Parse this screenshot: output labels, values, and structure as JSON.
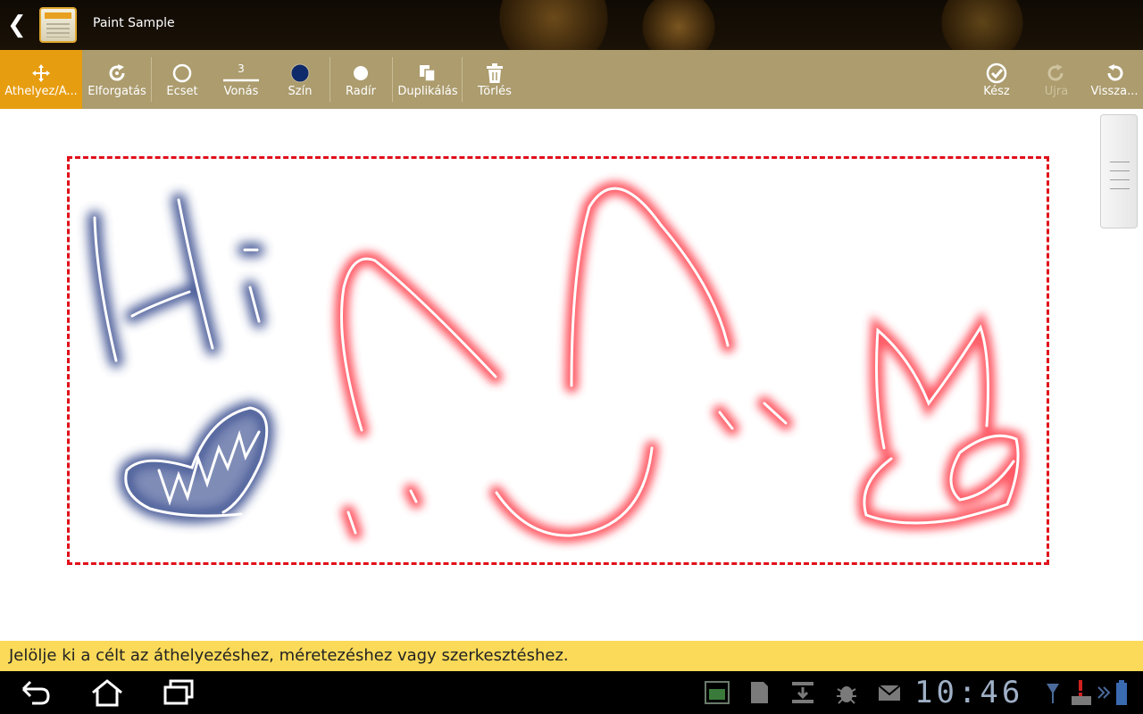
{
  "titlebar": {
    "title": "Paint Sample",
    "back_icon": "chevron-left-icon",
    "app_icon": "notebook-icon"
  },
  "toolbar": {
    "items": [
      {
        "label": "Áthelyez/Á...",
        "icon": "move-arrows-icon",
        "active": true
      },
      {
        "label": "Elforgatás",
        "icon": "rotate-icon"
      },
      {
        "label": "Ecset",
        "icon": "brush-circle-icon"
      },
      {
        "label": "Vonás",
        "icon": "stroke-width-icon",
        "value": "3"
      },
      {
        "label": "Szín",
        "icon": "color-swatch-icon",
        "color": "#0f2a6b"
      },
      {
        "label": "Radír",
        "icon": "eraser-dot-icon"
      },
      {
        "label": "Duplikálás",
        "icon": "duplicate-icon"
      },
      {
        "label": "Törlés",
        "icon": "trash-icon"
      },
      {
        "label": "Kész",
        "icon": "check-circle-icon"
      },
      {
        "label": "Újra",
        "icon": "redo-icon",
        "disabled": true
      },
      {
        "label": "Vissza...",
        "icon": "undo-icon"
      }
    ]
  },
  "canvas": {
    "drawing_text": "Hi",
    "colors": {
      "blue_glow": "#2a3f86",
      "red_glow": "#ff3040",
      "stroke": "#ffffff",
      "selection": "#e0101a"
    }
  },
  "hint": {
    "text": "Jelölje ki a célt az áthelyezéshez, méretezéshez vagy szerkesztéshez."
  },
  "status": {
    "time": "10:46"
  },
  "colors": {
    "toolbar_bg": "#ac9c6e",
    "toolbar_active": "#e79d10",
    "hint_bg": "#fada58"
  }
}
